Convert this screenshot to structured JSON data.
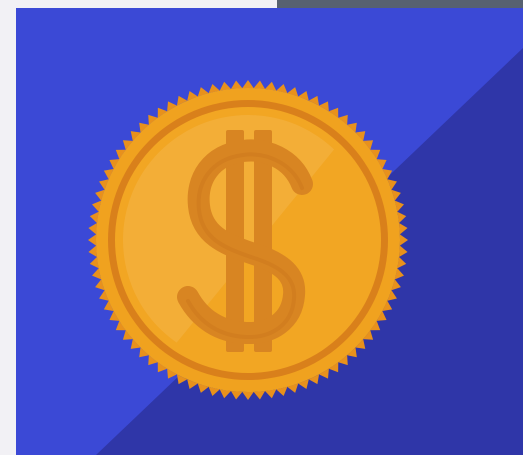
{
  "image": {
    "subject": "gold-coin-dollar-icon",
    "symbol": "$"
  },
  "colors": {
    "page_background": "#f2f1f5",
    "top_strip": "#576170",
    "tile_light_blue": "#3b49d6",
    "tile_shadow_blue": "#2f36a8",
    "coin_rim_teeth": "#e8911c",
    "coin_outer": "#f0a21f",
    "coin_inner_ring": "#d9801b",
    "coin_face": "#f2a623",
    "coin_highlight": "#f4b549",
    "dollar_sign": "#d88522",
    "dollar_sign_shadow": "#c8741b"
  }
}
